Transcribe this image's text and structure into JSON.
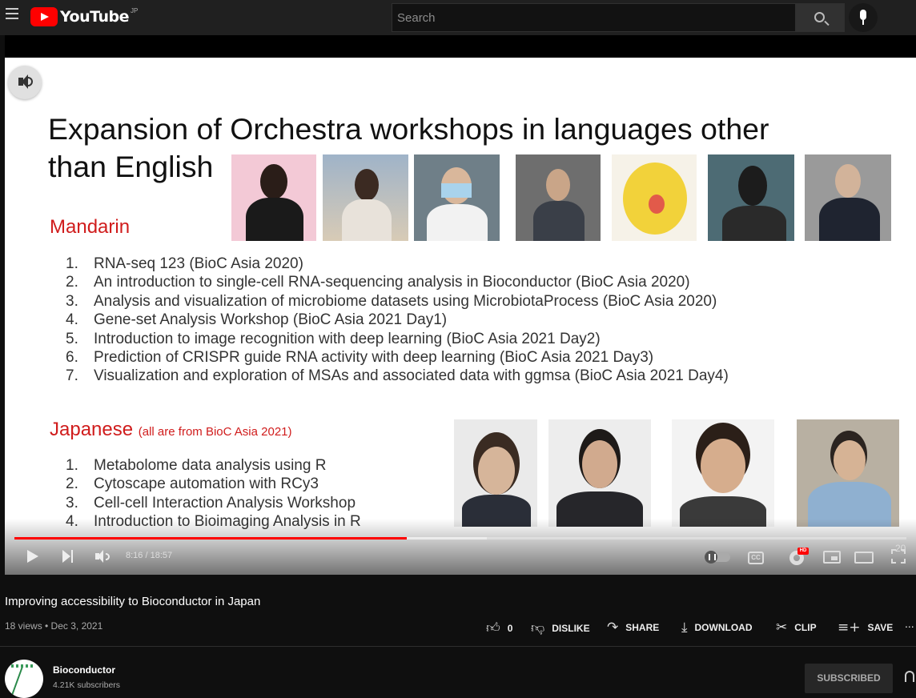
{
  "header": {
    "logo_text": "YouTube",
    "region": "JP",
    "search_placeholder": "Search"
  },
  "slide": {
    "title_line1": "Expansion of Orchestra workshops in languages other",
    "title_line2": "than English",
    "mandarin_heading": "Mandarin",
    "mandarin_items": [
      {
        "num": "1.",
        "text": "RNA-seq 123 (BioC Asia 2020)"
      },
      {
        "num": "2.",
        "text": "An introduction to single-cell RNA-sequencing analysis in Bioconductor (BioC Asia 2020)"
      },
      {
        "num": "3.",
        "text": "Analysis and visualization of microbiome datasets using MicrobiotaProcess (BioC Asia 2020)"
      },
      {
        "num": "4.",
        "text": "Gene-set Analysis Workshop (BioC Asia 2021 Day1)"
      },
      {
        "num": "5.",
        "text": "Introduction to image recognition with deep learning (BioC Asia 2021 Day2)"
      },
      {
        "num": "6.",
        "text": "Prediction of CRISPR guide RNA activity with deep learning (BioC Asia 2021 Day3)"
      },
      {
        "num": "7.",
        "text": "Visualization and exploration of MSAs and associated data with ggmsa (BioC Asia 2021 Day4)"
      }
    ],
    "japanese_heading": "Japanese",
    "japanese_sub": "(all are from BioC Asia 2021)",
    "japanese_items": [
      {
        "num": "1.",
        "text": "Metabolome data analysis using R"
      },
      {
        "num": "2.",
        "text": "Cytoscape automation with RCy3"
      },
      {
        "num": "3.",
        "text": "Cell-cell Interaction Analysis Workshop"
      },
      {
        "num": "4.",
        "text": "Introduction to Bioimaging Analysis in R"
      }
    ]
  },
  "player": {
    "time": "8:16 / 18:57",
    "progress_fraction": 0.4395,
    "cc_label": "CC",
    "hd_badge": "HD",
    "fullscreen_overlay": "20"
  },
  "video": {
    "title": "Improving accessibility to Bioconductor in Japan",
    "meta": "18 views • Dec 3, 2021",
    "like_count": "0",
    "dislike_label": "DISLIKE",
    "share_label": "SHARE",
    "download_label": "DOWNLOAD",
    "clip_label": "CLIP",
    "save_label": "SAVE",
    "more_label": "..."
  },
  "channel": {
    "name": "Bioconductor",
    "subscribers": "4.21K subscribers",
    "subscribe_label": "SUBSCRIBED"
  },
  "colors": {
    "accent_red": "#ff0000",
    "slide_red": "#d01c1c",
    "background": "#0f0f0f"
  }
}
